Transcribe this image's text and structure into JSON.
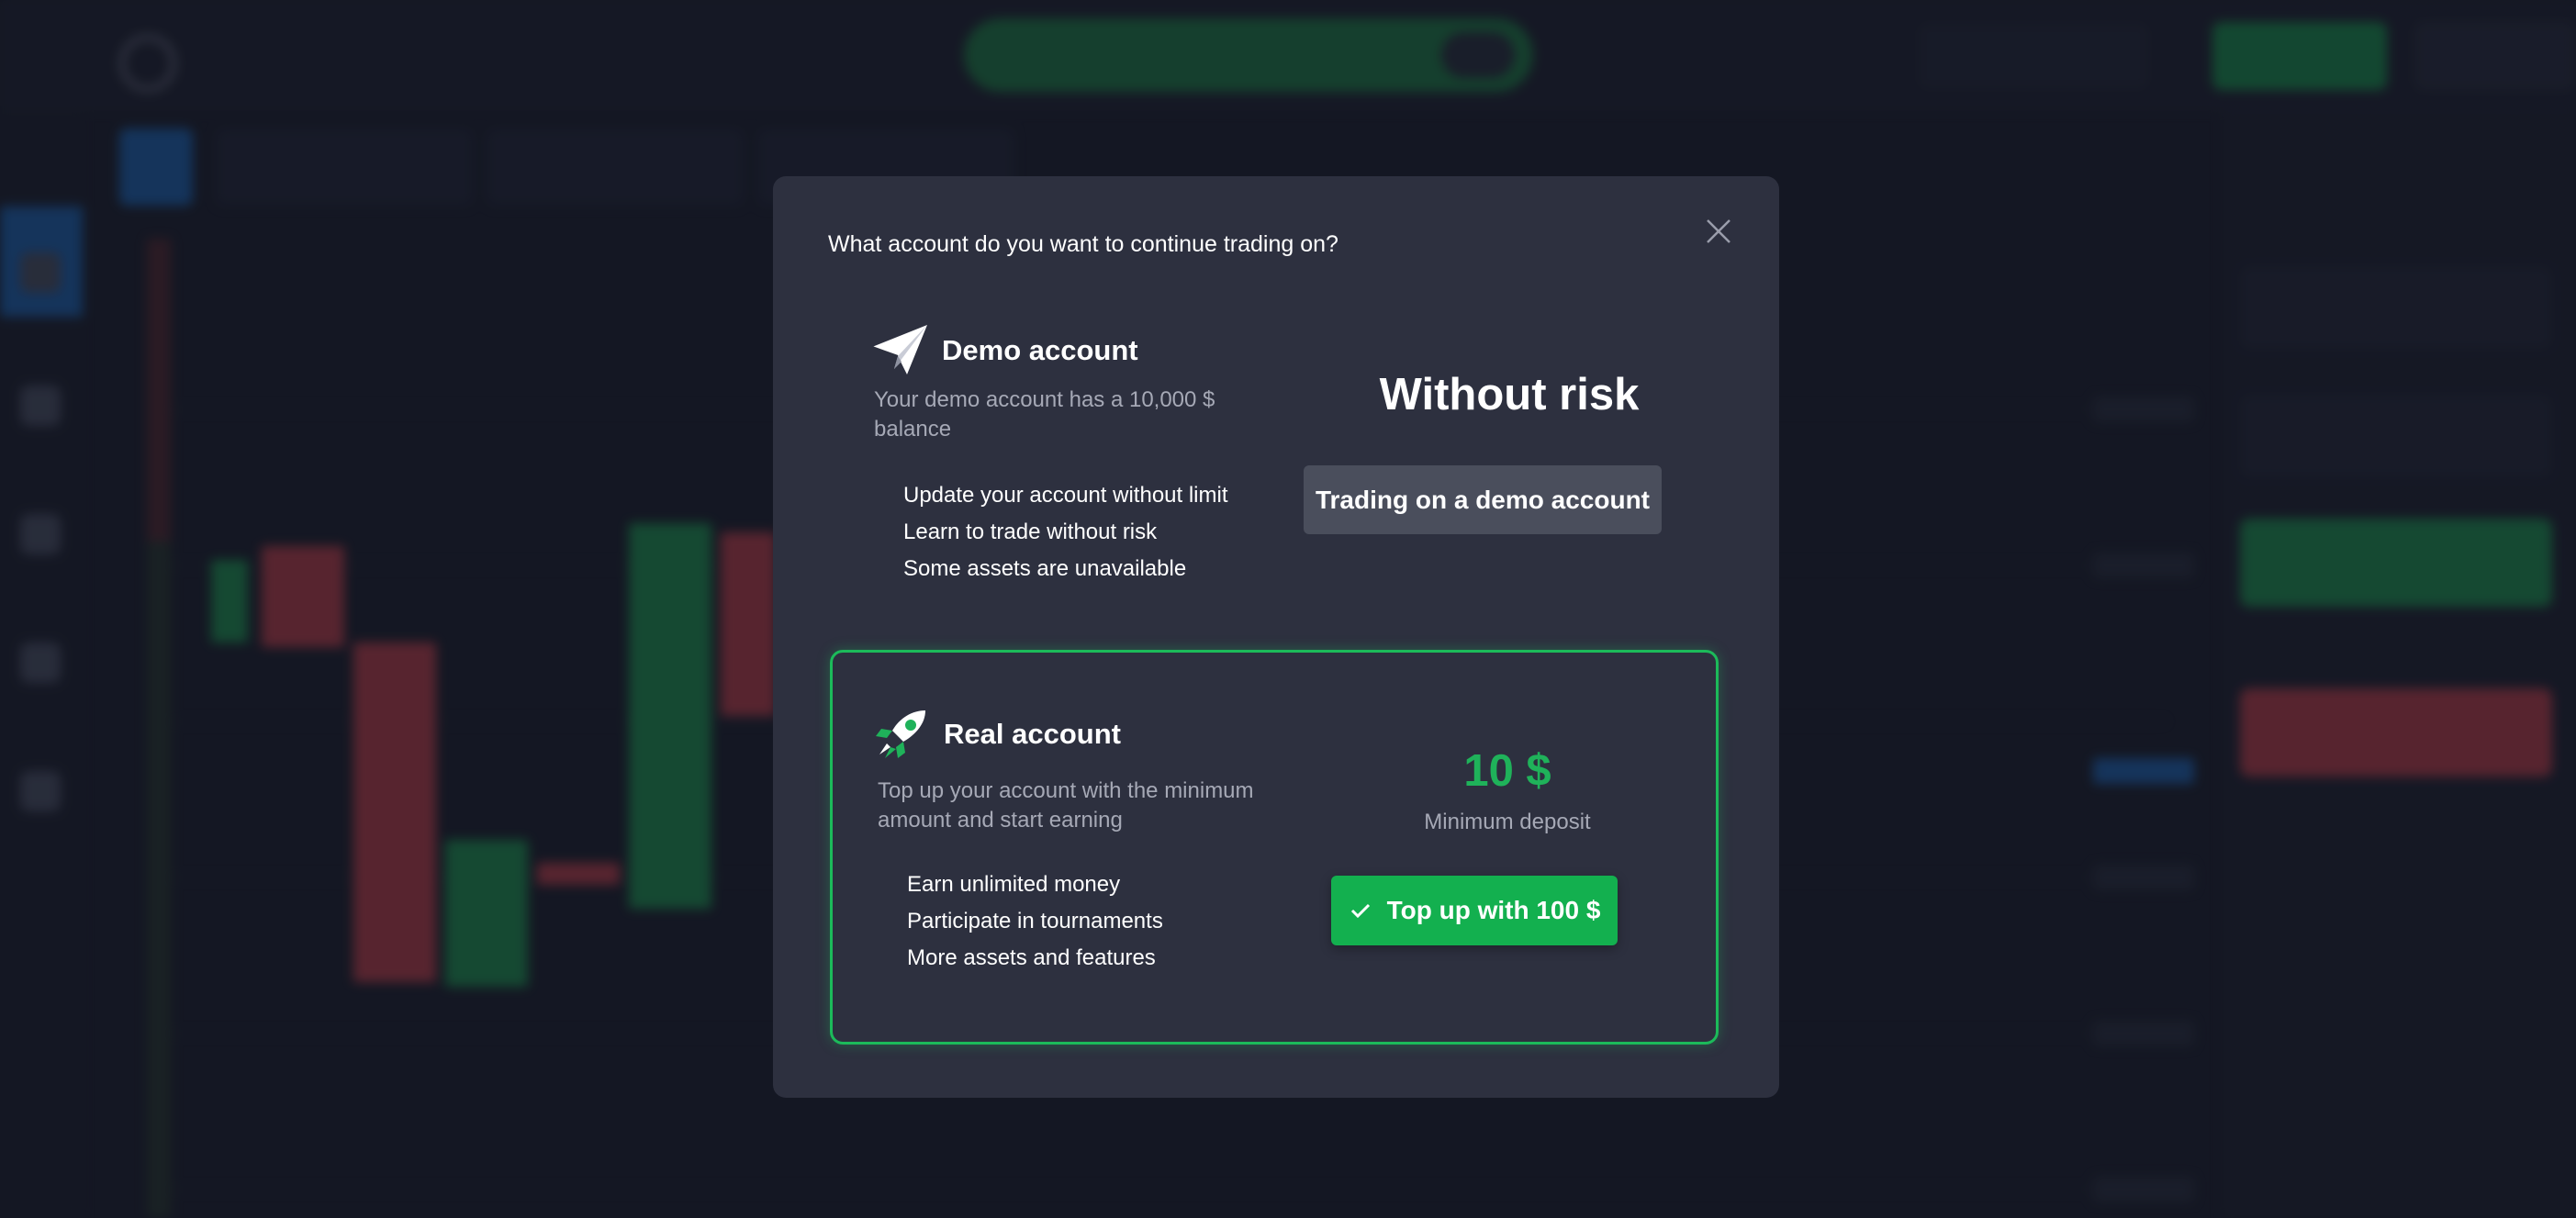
{
  "modal": {
    "title": "What account do you want to continue trading on?",
    "close_icon": "close-icon"
  },
  "demo": {
    "icon": "paper-plane-icon",
    "title": "Demo account",
    "description": "Your demo account has a 10,000 $ balance",
    "features": [
      "Update your account without limit",
      "Learn to trade without risk",
      "Some assets are unavailable"
    ],
    "headline": "Without risk",
    "button_label": "Trading on a demo account"
  },
  "real": {
    "icon": "rocket-icon",
    "title": "Real account",
    "description": "Top up your account with the minimum amount and start earning",
    "features": [
      "Earn unlimited money",
      "Participate in tournaments",
      "More assets and features"
    ],
    "min_amount": "10 $",
    "min_label": "Minimum deposit",
    "button_icon": "check-icon",
    "button_label": "Top up with 100 $"
  },
  "colors": {
    "modal_bg": "#2d303f",
    "accent_green": "#1fb25a",
    "button_green": "#13b04f",
    "demo_button": "#4a4e5c",
    "page_bg": "#1b1e2b"
  }
}
